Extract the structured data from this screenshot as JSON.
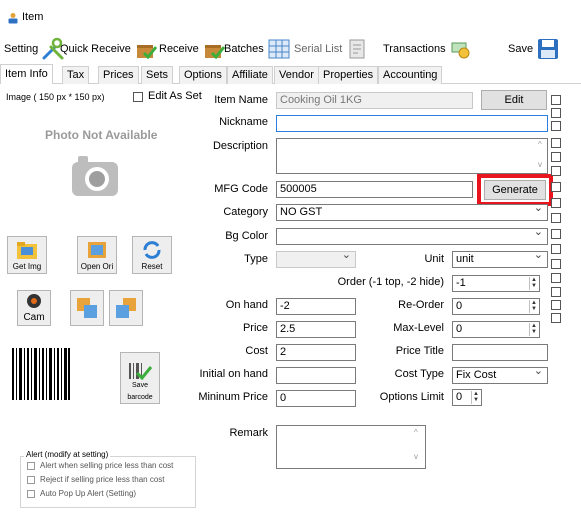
{
  "window": {
    "title": "Item"
  },
  "toolbar": {
    "setting": "Setting",
    "quick_receive": "Quick Receive",
    "receive": "Receive",
    "batches": "Batches",
    "serial_list": "Serial List",
    "transactions": "Transactions",
    "save": "Save"
  },
  "tabs": [
    "Item Info",
    "Tax",
    "Prices",
    "Sets",
    "Options",
    "Affiliate",
    "Vendor",
    "Properties",
    "Accounting"
  ],
  "image_panel": {
    "image_label": "Image ( 150 px * 150 px)",
    "edit_as_set": "Edit As Set",
    "photo_not_available": "Photo Not Available",
    "get_img": "Get Img",
    "open_ori": "Open Ori",
    "reset": "Reset",
    "cam": "Cam",
    "save_barcode_top": "Save",
    "save_barcode_bottom": "barcode"
  },
  "alert": {
    "title": "Alert (modify at setting)",
    "opt1": "Alert when selling price less than cost",
    "opt2": "Reject if selling price less than cost",
    "opt3": "Auto Pop Up Alert (Setting)"
  },
  "form": {
    "item_name_label": "Item Name",
    "item_name_value": "Cooking Oil 1KG",
    "edit_button": "Edit",
    "nickname_label": "Nickname",
    "nickname_value": "",
    "description_label": "Description",
    "description_value": "",
    "mfg_code_label": "MFG Code",
    "mfg_code_value": "500005",
    "generate_button": "Generate",
    "category_label": "Category",
    "category_value": "NO GST",
    "bg_color_label": "Bg Color",
    "bg_color_value": "",
    "type_label": "Type",
    "type_value": "",
    "unit_label": "Unit",
    "unit_value": "unit",
    "order_label": "Order (-1 top, -2 hide)",
    "order_value": "-1",
    "on_hand_label": "On hand",
    "on_hand_value": "-2",
    "reorder_label": "Re-Order",
    "reorder_value": "0",
    "price_label": "Price",
    "price_value": "2.5",
    "max_level_label": "Max-Level",
    "max_level_value": "0",
    "cost_label": "Cost",
    "cost_value": "2",
    "price_title_label": "Price Title",
    "price_title_value": "",
    "initial_on_hand_label": "Initial on hand",
    "initial_on_hand_value": "",
    "cost_type_label": "Cost Type",
    "cost_type_value": "Fix Cost",
    "minimum_price_label": "Mininum Price",
    "minimum_price_value": "0",
    "options_limit_label": "Options Limit",
    "options_limit_value": "0",
    "remark_label": "Remark",
    "remark_value": ""
  },
  "colors": {
    "highlight": "#e8141e",
    "field_border": "#7a7a7a",
    "focus": "#2f7be0"
  }
}
